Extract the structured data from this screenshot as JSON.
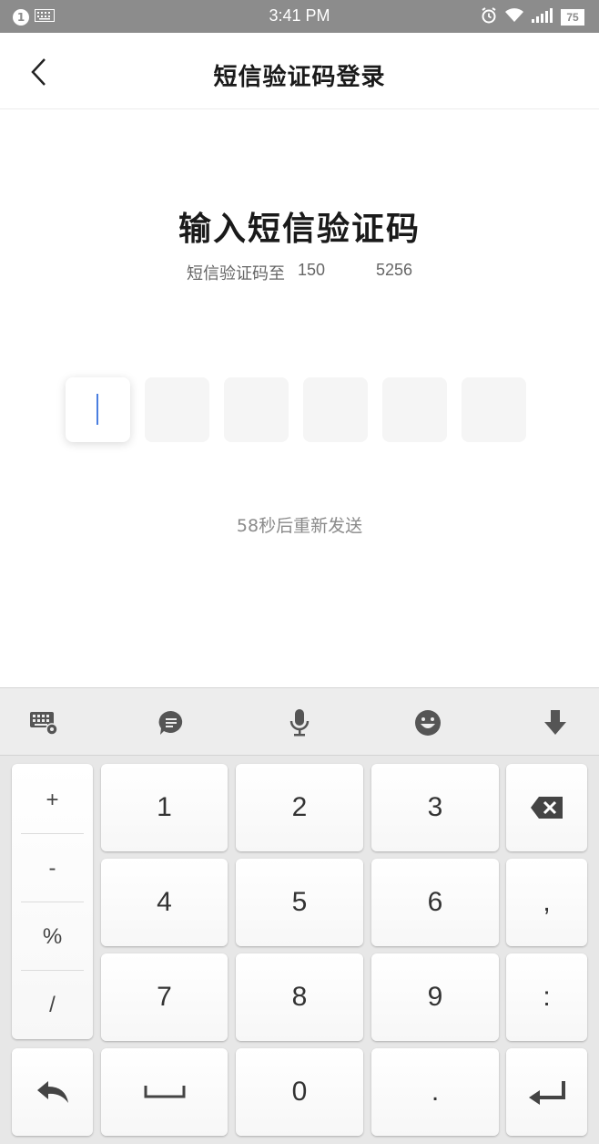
{
  "status_bar": {
    "notification_count": "1",
    "time": "3:41 PM",
    "battery": "75"
  },
  "header": {
    "title": "短信验证码登录"
  },
  "main": {
    "title": "输入短信验证码",
    "subtitle_prefix": "短信验证码至",
    "phone_start": "150",
    "phone_end": "5256",
    "code_length": 6,
    "resend_text": "58秒后重新发送"
  },
  "keyboard": {
    "toolbar": [
      "keyboard-settings-icon",
      "clipboard-icon",
      "microphone-icon",
      "emoji-icon",
      "hide-keyboard-icon"
    ],
    "symbols": [
      "+",
      "-",
      "%",
      "/"
    ],
    "digits": [
      "1",
      "2",
      "3",
      "4",
      "5",
      "6",
      "7",
      "8",
      "9",
      "0"
    ],
    "comma": ",",
    "colon": ":",
    "dot": "."
  },
  "colors": {
    "status_bar": "#8c8c8c",
    "caret": "#4a7ee0",
    "keyboard_bg": "#e7e7e7",
    "icon": "#555555"
  }
}
